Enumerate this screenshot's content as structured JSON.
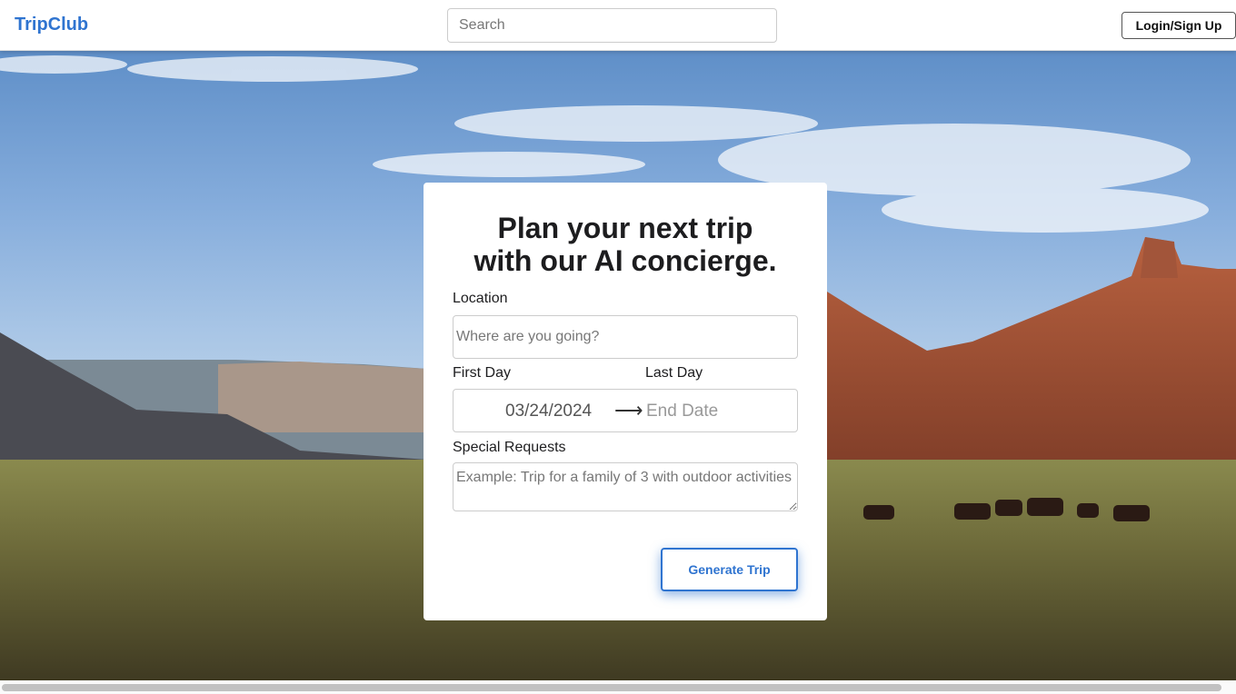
{
  "header": {
    "logo": "TripClub",
    "search_placeholder": "Search",
    "login_label": "Login/Sign Up"
  },
  "form": {
    "title_line1": "Plan your next trip",
    "title_line2": "with our AI concierge.",
    "location_label": "Location",
    "location_placeholder": "Where are you going?",
    "first_day_label": "First Day",
    "last_day_label": "Last Day",
    "start_date": "03/24/2024",
    "end_date_placeholder": "End Date",
    "special_requests_label": "Special Requests",
    "special_requests_placeholder": "Example: Trip for a family of 3 with outdoor activities",
    "generate_label": "Generate Trip",
    "arrow_icon": "arrow-right-icon"
  },
  "colors": {
    "accent": "#2f74d0"
  }
}
